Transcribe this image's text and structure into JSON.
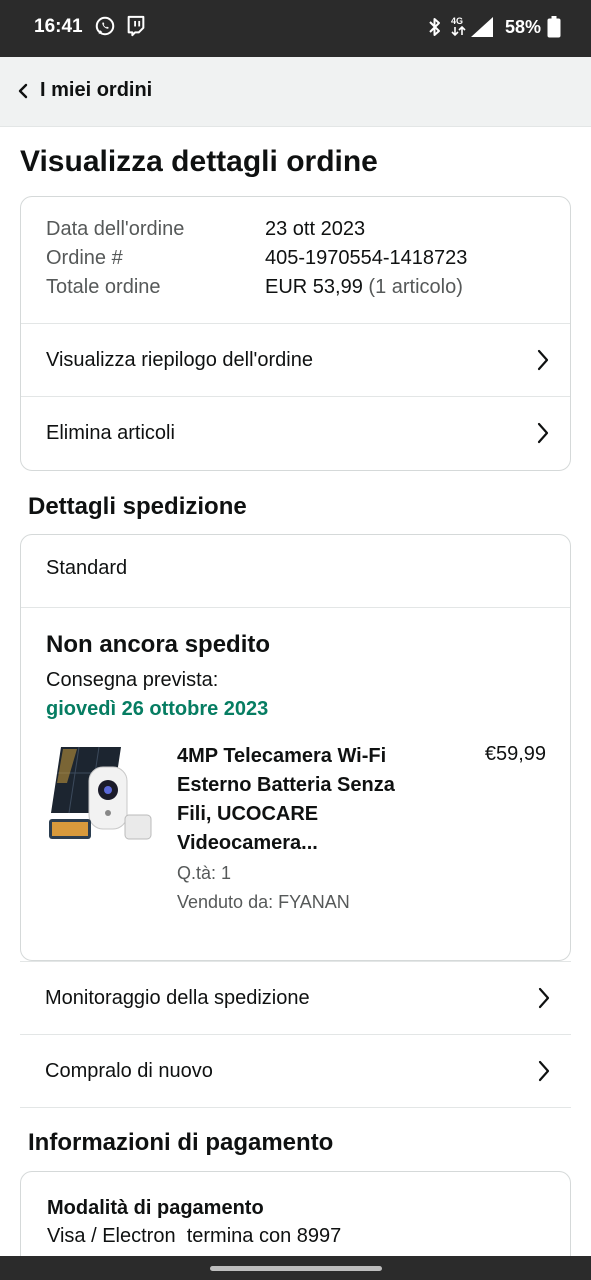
{
  "status_bar": {
    "time": "16:41",
    "network": "4G",
    "battery": "58%"
  },
  "nav": {
    "back_label": "I miei ordini"
  },
  "page_title": "Visualizza dettagli ordine",
  "order_summary": {
    "date_label": "Data dell'ordine",
    "date_value": "23 ott 2023",
    "number_label": "Ordine #",
    "number_value": "405-1970554-1418723",
    "total_label": "Totale ordine",
    "total_value": "EUR 53,99",
    "total_items": "(1 articolo)",
    "link_summary": "Visualizza riepilogo dell'ordine",
    "link_delete": "Elimina articoli"
  },
  "shipping": {
    "section_title": "Dettagli spedizione",
    "method": "Standard",
    "status": "Non ancora spedito",
    "expected_label": "Consegna prevista:",
    "expected_date": "giovedì 26 ottobre 2023",
    "product": {
      "title": "4MP Telecamera Wi-Fi Esterno Batteria Senza Fili, UCOCARE Videocamera...",
      "price": "€59,99",
      "quantity": "Q.tà: 1",
      "seller": "Venduto da: FYANAN",
      "image_icon": "security-camera-icon"
    },
    "link_tracking": "Monitoraggio della spedizione",
    "link_buy_again": "Compralo di nuovo"
  },
  "payment": {
    "section_title": "Informazioni di pagamento",
    "method_title": "Modalità di pagamento",
    "method_value": "Visa / Electron  termina con 8997"
  },
  "colors": {
    "status_bar": "#2b2b2b",
    "nav_bg": "#f0f2f2",
    "delivery_green": "#067d62",
    "muted_text": "#565959",
    "border": "#d5d9d9"
  }
}
